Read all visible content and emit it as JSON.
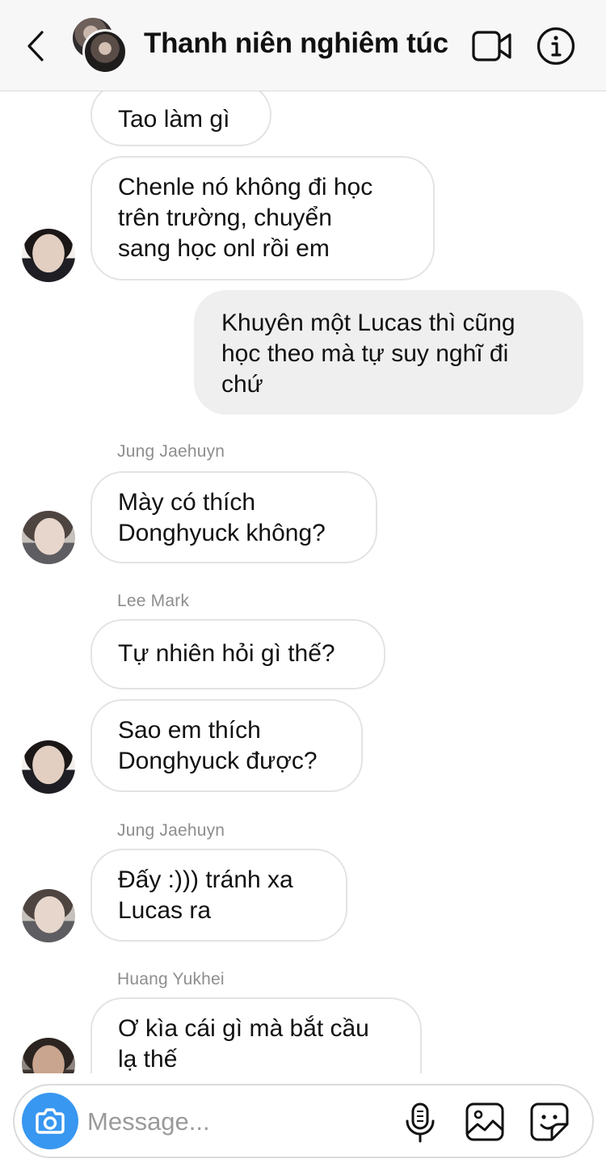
{
  "header": {
    "title": "Thanh niên nghiêm túc",
    "back_icon": "chevron-left-icon",
    "video_icon": "video-camera-icon",
    "info_icon": "info-icon"
  },
  "messages": [
    {
      "text": "Tao làm gì"
    },
    {
      "text": "Chenle nó không đi học\ntrên trường, chuyển\nsang học onl rồi em"
    },
    {
      "text": "Khuyên một Lucas thì cũng\nhọc theo mà tự suy nghĩ đi\nchứ"
    },
    {
      "sender": "Jung Jaehuyn",
      "text": "Mày có thích\nDonghyuck không?"
    },
    {
      "sender": "Lee Mark",
      "text": "Tự nhiên hỏi gì thế?"
    },
    {
      "text": "Sao em thích\nDonghyuck được?"
    },
    {
      "sender": "Jung Jaehuyn",
      "text": "Đấy :))) tránh xa\nLucas ra"
    },
    {
      "sender": "Huang Yukhei",
      "text": "Ơ kìa cái gì mà bắt cầu\nlạ thế"
    }
  ],
  "composer": {
    "placeholder": "Message...",
    "camera_icon": "camera-icon",
    "mic_icon": "microphone-icon",
    "gallery_icon": "image-gallery-icon",
    "sticker_icon": "sticker-icon"
  },
  "colors": {
    "accent": "#3897f0",
    "header_bg": "#f7f7f7",
    "outgoing_bubble": "#efefef",
    "incoming_border": "#e3e3e3",
    "sender_label": "#8e8e8e"
  }
}
